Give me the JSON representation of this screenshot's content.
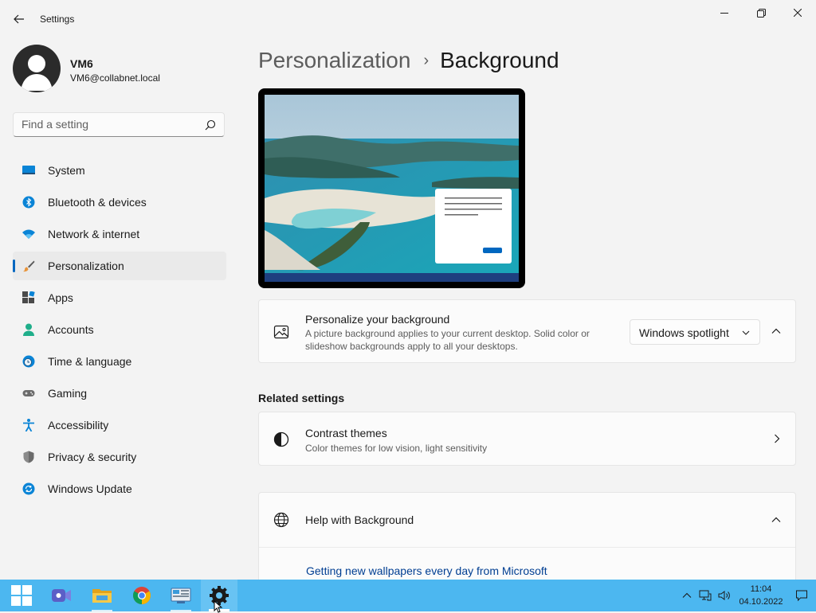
{
  "window": {
    "title": "Settings",
    "back_label": "Back"
  },
  "profile": {
    "name": "VM6",
    "email": "VM6@collabnet.local"
  },
  "search": {
    "placeholder": "Find a setting"
  },
  "nav": [
    {
      "label": "System",
      "icon": "system-icon"
    },
    {
      "label": "Bluetooth & devices",
      "icon": "bluetooth-icon"
    },
    {
      "label": "Network & internet",
      "icon": "wifi-icon"
    },
    {
      "label": "Personalization",
      "icon": "brush-icon",
      "selected": true
    },
    {
      "label": "Apps",
      "icon": "apps-icon"
    },
    {
      "label": "Accounts",
      "icon": "person-icon"
    },
    {
      "label": "Time & language",
      "icon": "clock-globe-icon"
    },
    {
      "label": "Gaming",
      "icon": "gamepad-icon"
    },
    {
      "label": "Accessibility",
      "icon": "accessibility-icon"
    },
    {
      "label": "Privacy & security",
      "icon": "shield-icon"
    },
    {
      "label": "Windows Update",
      "icon": "update-icon"
    }
  ],
  "breadcrumb": {
    "parent": "Personalization",
    "separator": "›",
    "current": "Background"
  },
  "background_card": {
    "title": "Personalize your background",
    "description": "A picture background applies to your current desktop. Solid color or slideshow backgrounds apply to all your desktops.",
    "dropdown_value": "Windows spotlight",
    "icon": "image-icon"
  },
  "related_settings": {
    "heading": "Related settings",
    "contrast": {
      "title": "Contrast themes",
      "description": "Color themes for low vision, light sensitivity",
      "icon": "contrast-icon"
    }
  },
  "help": {
    "title": "Help with Background",
    "link": "Getting new wallpapers every day from Microsoft",
    "icon": "globe-icon"
  },
  "taskbar": {
    "apps": [
      "start-icon",
      "teams-icon",
      "file-explorer-icon",
      "chrome-icon",
      "control-panel-icon",
      "settings-icon"
    ],
    "time": "11:04",
    "date": "04.10.2022"
  },
  "colors": {
    "accent": "#0067c0",
    "taskbar": "#4cb7f0",
    "link": "#003e92"
  }
}
